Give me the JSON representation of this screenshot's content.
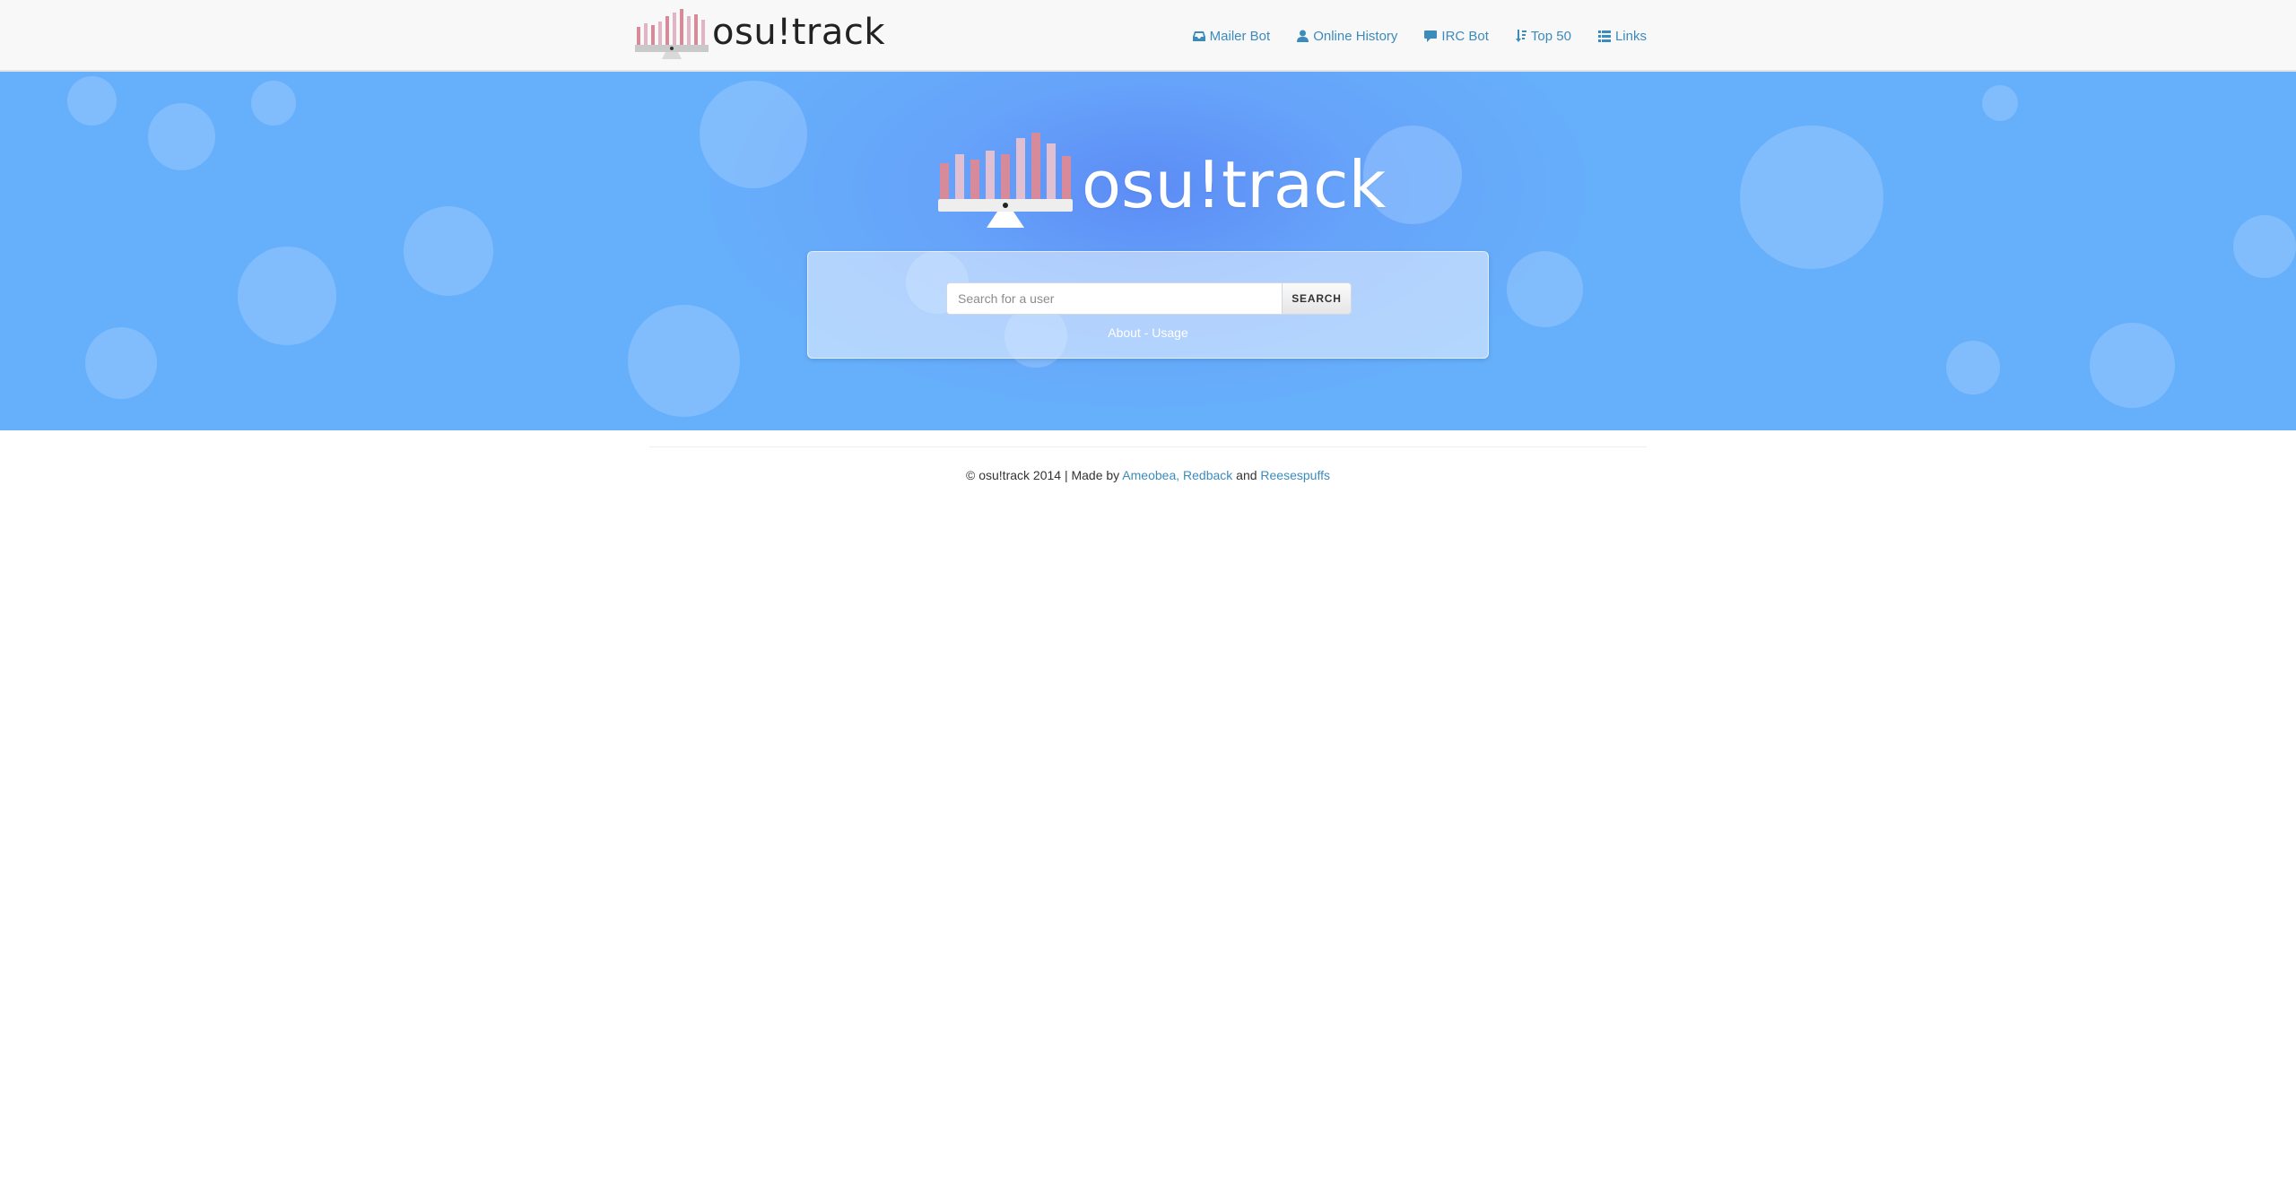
{
  "navbar": {
    "brand_text": "osu!track",
    "links": [
      {
        "label": "Mailer Bot",
        "icon": "inbox-icon"
      },
      {
        "label": "Online History",
        "icon": "user-icon"
      },
      {
        "label": "IRC Bot",
        "icon": "comment-icon"
      },
      {
        "label": "Top 50",
        "icon": "sort-icon"
      },
      {
        "label": "Links",
        "icon": "list-icon"
      }
    ]
  },
  "hero": {
    "title": "osu!track",
    "search": {
      "placeholder": "Search for a user",
      "button_label": "SEARCH"
    },
    "about_label": "About",
    "separator": "-",
    "usage_label": "Usage"
  },
  "footer": {
    "copyright": "© osu!track 2014 | Made by",
    "author_link": "Ameobea, Redback",
    "and": "and",
    "author_link_2": "Reesespuffs"
  },
  "colors": {
    "link": "#3b8bbb",
    "hero_bg": "#66b0fb",
    "hero_center": "#5c8cf5",
    "navbar_bg": "#f8f8f8"
  }
}
